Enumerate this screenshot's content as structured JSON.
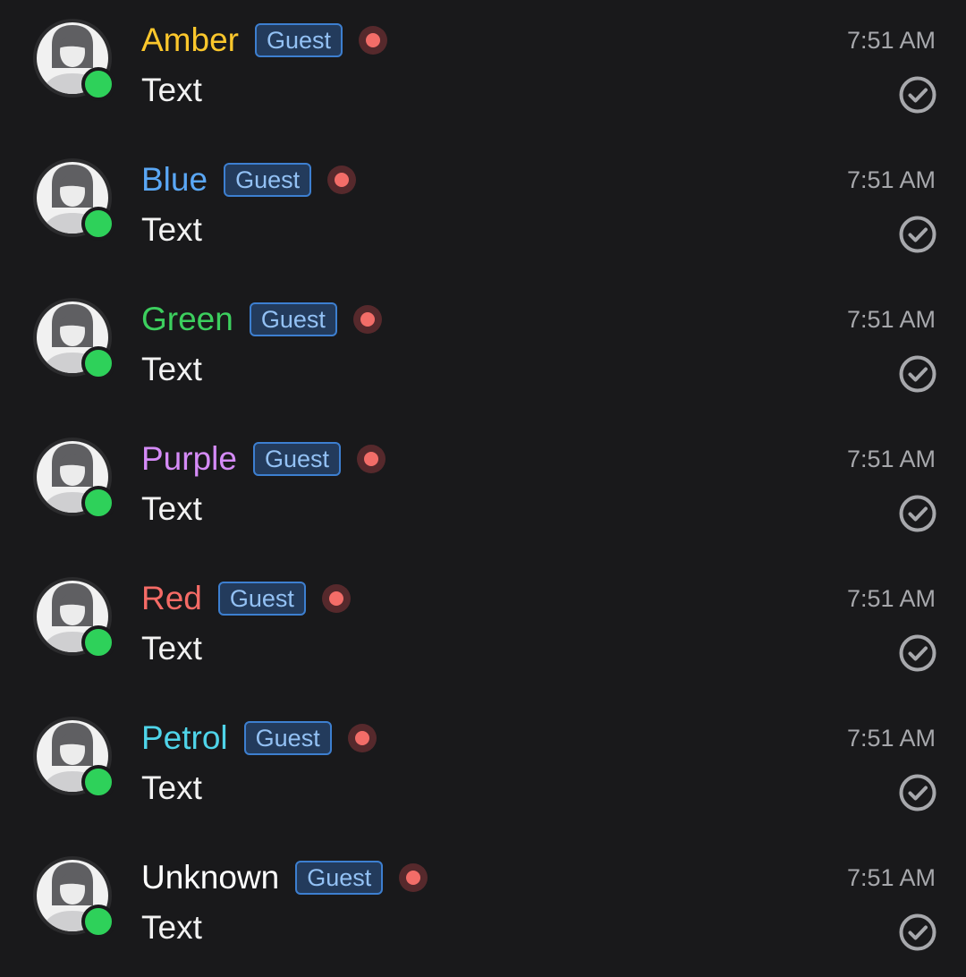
{
  "messages": [
    {
      "name": "Amber",
      "name_color": "#fbc72c",
      "badge": "Guest",
      "time": "7:51 AM",
      "text": "Text"
    },
    {
      "name": "Blue",
      "name_color": "#5aa7f5",
      "badge": "Guest",
      "time": "7:51 AM",
      "text": "Text"
    },
    {
      "name": "Green",
      "name_color": "#3ccf5e",
      "badge": "Guest",
      "time": "7:51 AM",
      "text": "Text"
    },
    {
      "name": "Purple",
      "name_color": "#d58bf7",
      "badge": "Guest",
      "time": "7:51 AM",
      "text": "Text"
    },
    {
      "name": "Red",
      "name_color": "#f56b66",
      "badge": "Guest",
      "time": "7:51 AM",
      "text": "Text"
    },
    {
      "name": "Petrol",
      "name_color": "#4fd4e9",
      "badge": "Guest",
      "time": "7:51 AM",
      "text": "Text"
    },
    {
      "name": "Unknown",
      "name_color": "#ffffff",
      "badge": "Guest",
      "time": "7:51 AM",
      "text": "Text"
    }
  ],
  "icons": {
    "avatar": "user-avatar-icon",
    "presence": "online-status-icon",
    "recording": "recording-dot-icon",
    "read_receipt": "check-circle-icon"
  },
  "colors": {
    "background": "#19191b",
    "online": "#2ed15a",
    "badge_border": "#3d7fd0",
    "badge_fill": "#233b5c",
    "badge_text": "#93c1f4",
    "dot": "#f36d68",
    "timestamp": "#a7a8ac"
  }
}
